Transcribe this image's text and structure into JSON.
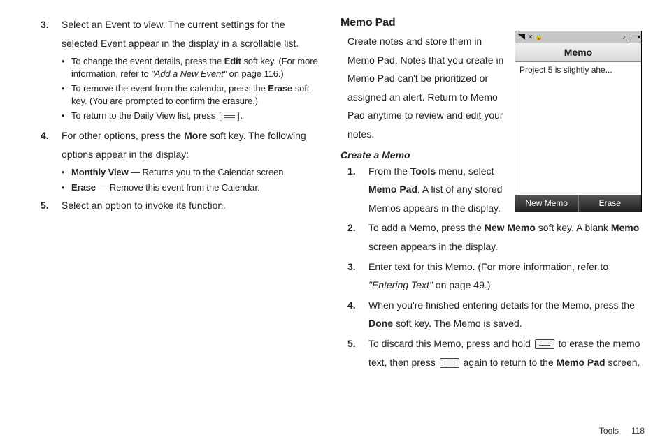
{
  "left": {
    "n3_a": "Select an Event to view. The current settings for the",
    "n3_b": "selected Event appear in the display in a scrollable list.",
    "n3_bul1_a": "To change the event details, press the ",
    "n3_bul1_bold": "Edit",
    "n3_bul1_b": " soft key. (For more information, refer to ",
    "n3_bul1_ref": "\"Add a New Event\"",
    "n3_bul1_c": "  on page 116.)",
    "n3_bul2_a": "To remove the event from the calendar, press the ",
    "n3_bul2_bold": "Erase",
    "n3_bul2_b": " soft key. (You are prompted to confirm the erasure.)",
    "n3_bul3_a": "To return to the Daily View list, press ",
    "n3_bul3_b": ".",
    "n4_a": "For other options, press the ",
    "n4_bold": "More",
    "n4_b": " soft key. The following options appear in the display:",
    "n4_bul1_bold": "Monthly View",
    "n4_bul1_rest": " — Returns you to the Calendar screen.",
    "n4_bul2_bold": "Erase",
    "n4_bul2_rest": " — Remove this event from the Calendar.",
    "n5": "Select an option to invoke its function."
  },
  "right": {
    "heading": "Memo Pad",
    "intro": "Create notes and store them in Memo Pad. Notes that you create in Memo Pad can't be prioritized or assigned an alert. Return to Memo Pad anytime to review and edit your notes.",
    "sub": "Create a Memo",
    "s1_a": "From the ",
    "s1_bold1": "Tools",
    "s1_b": " menu, select ",
    "s1_bold2": "Memo Pad",
    "s1_c": ". A list of any stored Memos appears in the display.",
    "s2_a": "To add a Memo, press the ",
    "s2_bold1": "New Memo",
    "s2_b": " soft key. A blank ",
    "s2_bold2": "Memo",
    "s2_c": " screen appears in the display.",
    "s3_a": "Enter text for this Memo. (For more information, refer to ",
    "s3_ref": "\"Entering Text\"",
    "s3_b": "  on page 49.)",
    "s4_a": "When you're finished entering details for the Memo, press the ",
    "s4_bold": "Done",
    "s4_b": " soft key. The Memo is saved.",
    "s5_a": "To discard this Memo, press and hold ",
    "s5_mid": " to erase the memo text, then press ",
    "s5_b": " again to return to the ",
    "s5_bold": "Memo Pad",
    "s5_c": " screen."
  },
  "phone": {
    "title": "Memo",
    "memo_line": "Project 5 is slightly ahe...",
    "left_soft": "New Memo",
    "right_soft": "Erase"
  },
  "footer": {
    "section": "Tools",
    "page": "118"
  },
  "nums": {
    "n3": "3.",
    "n4": "4.",
    "n5": "5.",
    "r1": "1.",
    "r2": "2.",
    "r3": "3.",
    "r4": "4.",
    "r5": "5."
  }
}
